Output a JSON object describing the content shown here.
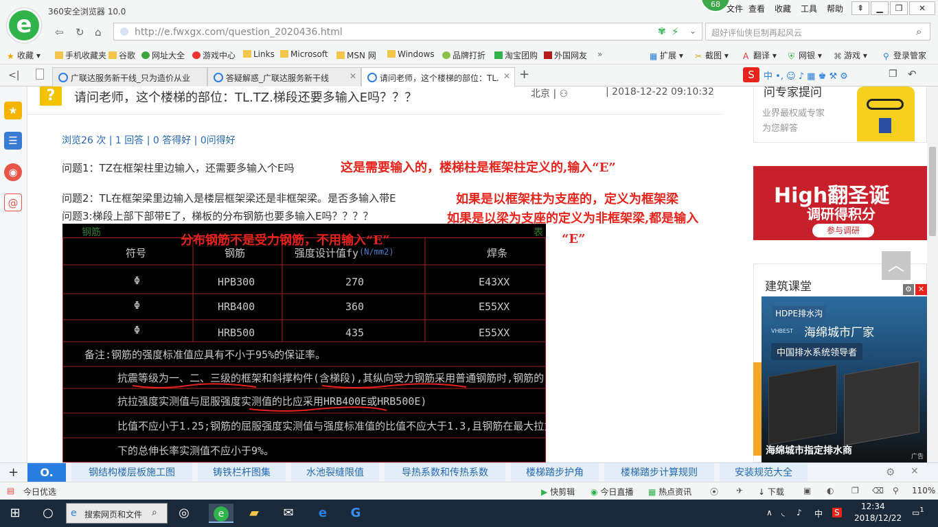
{
  "browser": {
    "title": "360安全浏览器 10.0",
    "badge": "68",
    "menu": [
      "文件",
      "查看",
      "收藏",
      "工具",
      "帮助"
    ],
    "url": "http://e.fwxgx.com/question_2020436.html",
    "url_host": "e.fwxgx.com",
    "search_placeholder": "超好评仙侠巨制再起风云"
  },
  "favorites": {
    "items": [
      "收藏",
      "手机收藏夹",
      "谷歌",
      "网址大全",
      "游戏中心",
      "Links",
      "Microsoft",
      "MSN 网",
      "Windows",
      "品牌打折",
      "淘宝团购",
      "外国网友"
    ],
    "more": "»",
    "right": [
      "扩展",
      "截图",
      "翻译",
      "网银",
      "游戏",
      "登录管家"
    ]
  },
  "tabs": [
    {
      "label": "广联达服务新干线_只为造价从业"
    },
    {
      "label": "答疑解惑_广联达服务新干线"
    },
    {
      "label": "请问老师，这个楼梯的部位：TL."
    }
  ],
  "question": {
    "icon": "?",
    "title": "请问老师，这个楼梯的部位：TL.TZ.梯段还要多输入E吗？？？",
    "location": "北京",
    "date": "| 2018-12-22 09:10:32",
    "stats": "浏览26 次 | 1 回答 | 0 答得好 | 0问得好",
    "p1": "问题1：TZ在框架柱里边输入，还需要多输入个E吗",
    "p2": "问题2：TL在框架梁里边输入是楼层框架梁还是非框架梁。是否多输入带E",
    "p3": "问题3:梯段上部下部带E了，梯板的分布钢筋也要多输入E吗？？？？",
    "a1": "这是需要输入的，楼梯柱是框架柱定义的,输入“E”",
    "a2": "如果是以框架柱为支座的，定义为框架梁",
    "a3": "如果是以梁为支座的定义为非框架梁,都是输入",
    "a3b": "“E”",
    "a4": "分布钢筋不是受力钢筋，不用输入“E”"
  },
  "cad_table": {
    "corner_left": "钢筋",
    "corner_right": "表",
    "headers": [
      "符号",
      "钢筋",
      "强度设计值fy",
      "(N/mm2)",
      "焊条"
    ],
    "rows": [
      [
        "Φ",
        "HPB300",
        "270",
        "E43XX"
      ],
      [
        "Φ",
        "HRB400",
        "360",
        "E55XX"
      ],
      [
        "Φ",
        "HRB500",
        "435",
        "E55XX"
      ]
    ],
    "notes": [
      "备注:钢筋的强度标准值应具有不小于95%的保证率。",
      "抗震等级为一、二、三级的框架和斜撑构件(含梯段),其纵向受力钢筋采用普通钢筋时,钢筋的",
      "抗拉强度实测值与屈服强度实测值的比应采用HRB400E或HRB500E)",
      "比值不应小于1.25;钢筋的屈服强度实测值与强度标准值的比值不应大于1.3,且钢筋在最大拉力",
      "下的总伸长率实测值不应小于9%。"
    ]
  },
  "sidebar_ads": {
    "expert_title": "问专家提问",
    "expert_sub1": "业界最权威专家",
    "expert_sub2": "为您解答",
    "high_title": "High翻圣诞",
    "high_sub": "调研得积分",
    "high_btn": "参与调研",
    "course_title": "建筑课堂",
    "hdpe_brand": "HDPE排水沟",
    "hdpe_title": "海绵城市厂家",
    "hdpe_sub": "中国排水系统领导者",
    "hdpe_small": "VHBEST",
    "hdpe_caption": "海绵城市指定排水商",
    "ad_label": "广告"
  },
  "bottom_links": [
    "钢结构楼层板施工图",
    "铸铁栏杆图集",
    "水池裂缝限值",
    "导热系数和传热系数",
    "楼梯踏步护角",
    "楼梯踏步计算规则",
    "安装规范大全"
  ],
  "statusbar": {
    "left": "今日优选",
    "items": [
      "快剪辑",
      "今日直播",
      "热点资讯",
      "下载"
    ],
    "zoom": "110%"
  },
  "taskbar": {
    "search_placeholder": "搜索网页和文件",
    "time": "12:34",
    "date": "2018/12/22",
    "ime": "中",
    "notify": "1"
  }
}
